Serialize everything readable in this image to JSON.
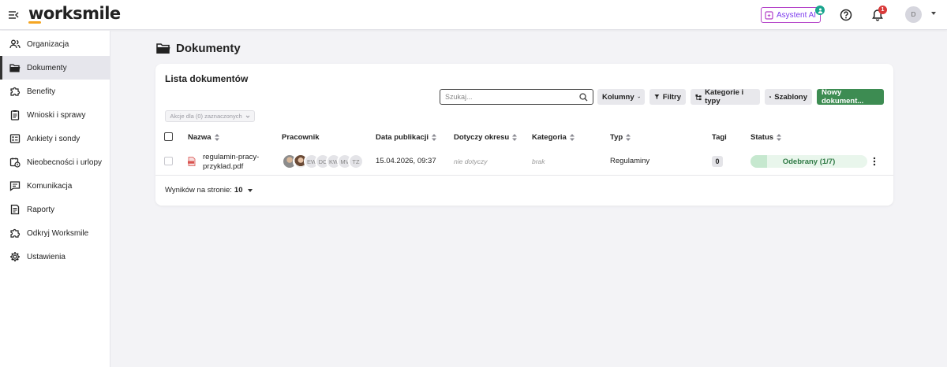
{
  "app": {
    "logo": "worksmile"
  },
  "header": {
    "ai_label": "Asystent AI",
    "notification_count": "1",
    "avatar_initial": "D"
  },
  "sidebar": {
    "items": [
      {
        "label": "Organizacja",
        "icon": "people-icon"
      },
      {
        "label": "Dokumenty",
        "icon": "folder-icon",
        "active": true
      },
      {
        "label": "Benefity",
        "icon": "puzzle-icon"
      },
      {
        "label": "Wnioski i sprawy",
        "icon": "clipboard-icon"
      },
      {
        "label": "Ankiety i sondy",
        "icon": "survey-icon"
      },
      {
        "label": "Nieobecności i urlopy",
        "icon": "calendar-clock-icon"
      },
      {
        "label": "Komunikacja",
        "icon": "chat-icon"
      },
      {
        "label": "Raporty",
        "icon": "report-icon"
      },
      {
        "label": "Odkryj Worksmile",
        "icon": "puzzle-outline-icon"
      },
      {
        "label": "Ustawienia",
        "icon": "gear-icon"
      }
    ]
  },
  "page": {
    "title": "Dokumenty"
  },
  "card": {
    "title": "Lista dokumentów",
    "search_placeholder": "Szukaj...",
    "buttons": {
      "columns": "Kolumny",
      "filters": "Filtry",
      "categories": "Kategorie i typy",
      "templates": "Szablony",
      "new_doc": "Nowy dokument..."
    },
    "bulk_action": "Akcje dla (0) zaznaczonych"
  },
  "table": {
    "headers": {
      "name": "Nazwa",
      "employee": "Pracownik",
      "published": "Data publikacji",
      "period": "Dotyczy okresu",
      "category": "Kategoria",
      "type": "Typ",
      "tags": "Tagi",
      "status": "Status"
    },
    "rows": [
      {
        "name": "regulamin-pracy-przyklad.pdf",
        "employees": [
          "",
          "",
          "EW",
          "DC",
          "KW",
          "MV",
          "TZ"
        ],
        "published": "15.04.2026, 09:37",
        "period": "nie dotyczy",
        "category": "brak",
        "type": "Regulaminy",
        "tags": "0",
        "status": "Odebrany (1/7)",
        "status_progress": 0.143
      }
    ]
  },
  "pagination": {
    "label": "Wyników na stronie:",
    "value": "10"
  },
  "colors": {
    "primary_green": "#3d8c52",
    "ai_purple": "#b341c8",
    "badge_red": "#d93a3a"
  }
}
